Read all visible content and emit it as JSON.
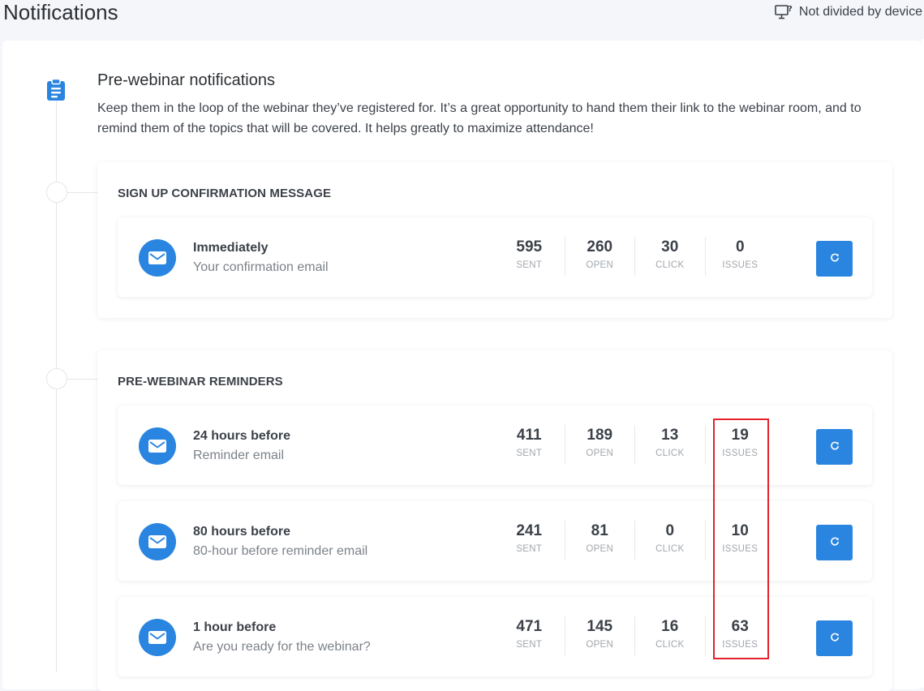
{
  "header": {
    "title": "Notifications",
    "device_filter": "Not divided by device"
  },
  "section": {
    "title": "Pre-webinar notifications",
    "description": "Keep them in the loop of the webinar they’ve registered for. It’s a great opportunity to hand them their link to the webinar room, and to remind them of the topics that will be covered. It helps greatly to maximize attendance!"
  },
  "stat_labels": {
    "sent": "SENT",
    "open": "OPEN",
    "click": "CLICK",
    "issues": "ISSUES"
  },
  "groups": [
    {
      "title": "SIGN UP CONFIRMATION MESSAGE",
      "messages": [
        {
          "title": "Immediately",
          "subtitle": "Your confirmation email",
          "sent": "595",
          "open": "260",
          "click": "30",
          "issues": "0"
        }
      ]
    },
    {
      "title": "PRE-WEBINAR REMINDERS",
      "messages": [
        {
          "title": "24 hours before",
          "subtitle": "Reminder email",
          "sent": "411",
          "open": "189",
          "click": "13",
          "issues": "19"
        },
        {
          "title": "80 hours before",
          "subtitle": "80-hour before reminder email",
          "sent": "241",
          "open": "81",
          "click": "0",
          "issues": "10"
        },
        {
          "title": "1 hour before",
          "subtitle": "Are you ready for the webinar?",
          "sent": "471",
          "open": "145",
          "click": "16",
          "issues": "63"
        }
      ]
    }
  ],
  "colors": {
    "accent": "#2a85e0",
    "highlight": "#e6212b"
  },
  "icons": {
    "device": "monitor-question-icon",
    "section": "clipboard-icon",
    "message": "envelope-icon",
    "refresh": "refresh-icon"
  }
}
